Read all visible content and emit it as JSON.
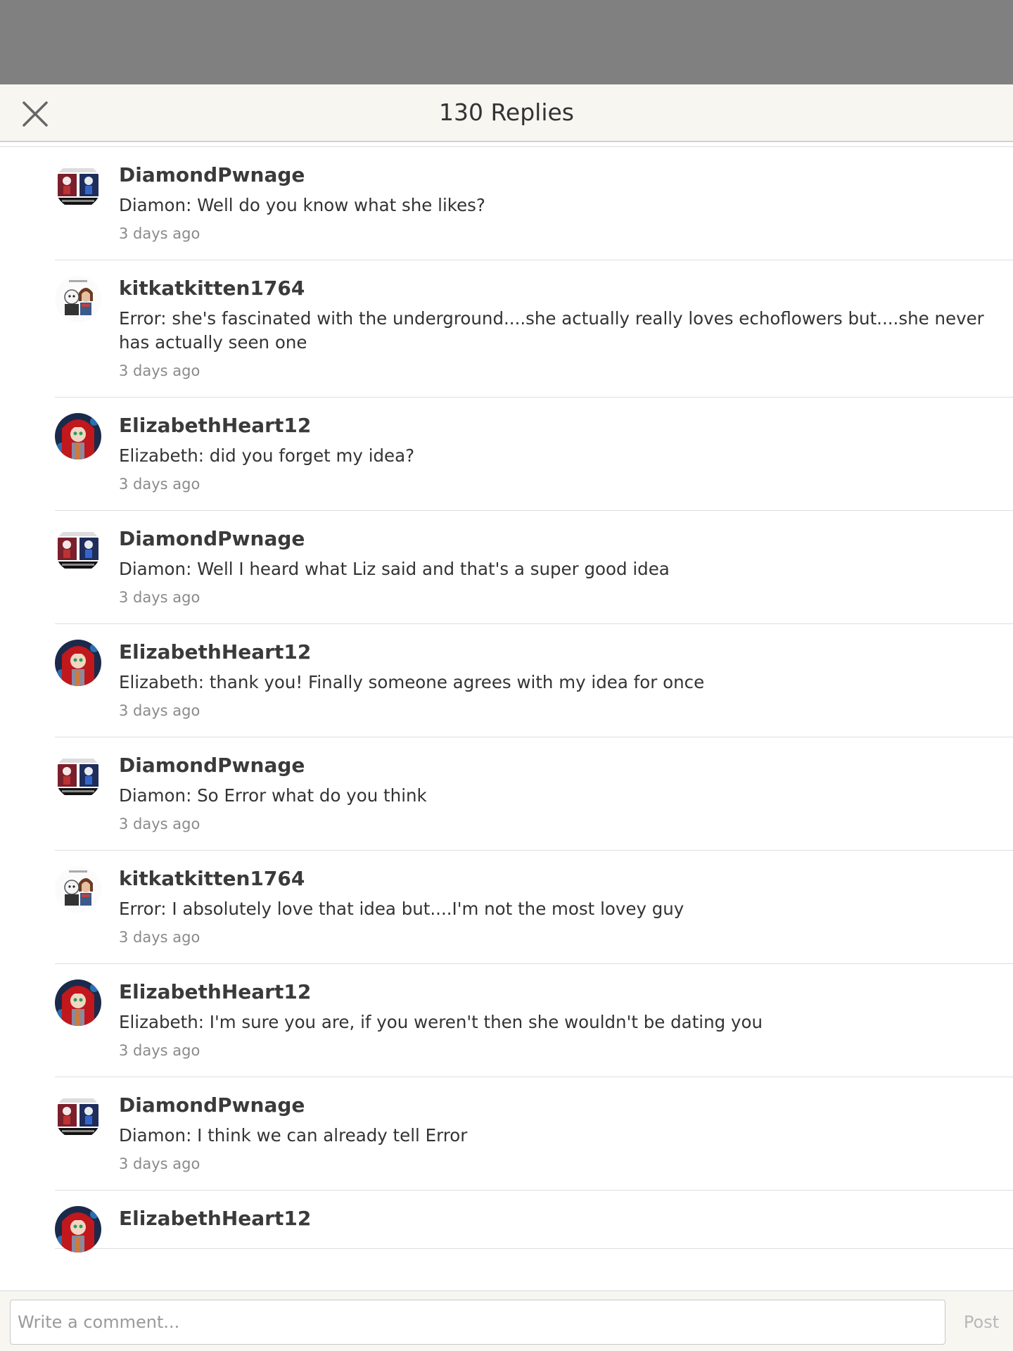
{
  "header": {
    "title": "130 Replies",
    "close_icon": "close-icon"
  },
  "replies": [
    {
      "username": "DiamondPwnage",
      "text": "Diamon: Well do you know what she likes?",
      "time": "3 days ago",
      "avatar": "diamond"
    },
    {
      "username": "kitkatkitten1764",
      "text": "Error: she's fascinated with the underground....she actually really loves echoflowers but....she never has actually seen one",
      "time": "3 days ago",
      "avatar": "kitkat"
    },
    {
      "username": "ElizabethHeart12",
      "text": "Elizabeth: did you forget my idea?",
      "time": "3 days ago",
      "avatar": "elizabeth"
    },
    {
      "username": "DiamondPwnage",
      "text": "Diamon: Well I heard what Liz said and that's a super good idea",
      "time": "3 days ago",
      "avatar": "diamond"
    },
    {
      "username": "ElizabethHeart12",
      "text": "Elizabeth: thank you! Finally someone agrees with my idea for once",
      "time": "3 days ago",
      "avatar": "elizabeth"
    },
    {
      "username": "DiamondPwnage",
      "text": "Diamon: So Error what do you think",
      "time": "3 days ago",
      "avatar": "diamond"
    },
    {
      "username": "kitkatkitten1764",
      "text": "Error: I absolutely love that idea but....I'm not the most lovey guy",
      "time": "3 days ago",
      "avatar": "kitkat"
    },
    {
      "username": "ElizabethHeart12",
      "text": "Elizabeth: I'm sure you are, if you weren't then she wouldn't be dating you",
      "time": "3 days ago",
      "avatar": "elizabeth"
    },
    {
      "username": "DiamondPwnage",
      "text": "Diamon: I think we can already tell Error",
      "time": "3 days ago",
      "avatar": "diamond"
    },
    {
      "username": "ElizabethHeart12",
      "text": "",
      "time": "",
      "avatar": "elizabeth"
    }
  ],
  "composer": {
    "placeholder": "Write a comment...",
    "post_label": "Post"
  },
  "colors": {
    "overlay": "#808080",
    "header_bg": "#f7f6f1",
    "text": "#333333",
    "muted": "#8a8a8a",
    "post_disabled": "#b8b8b8"
  }
}
